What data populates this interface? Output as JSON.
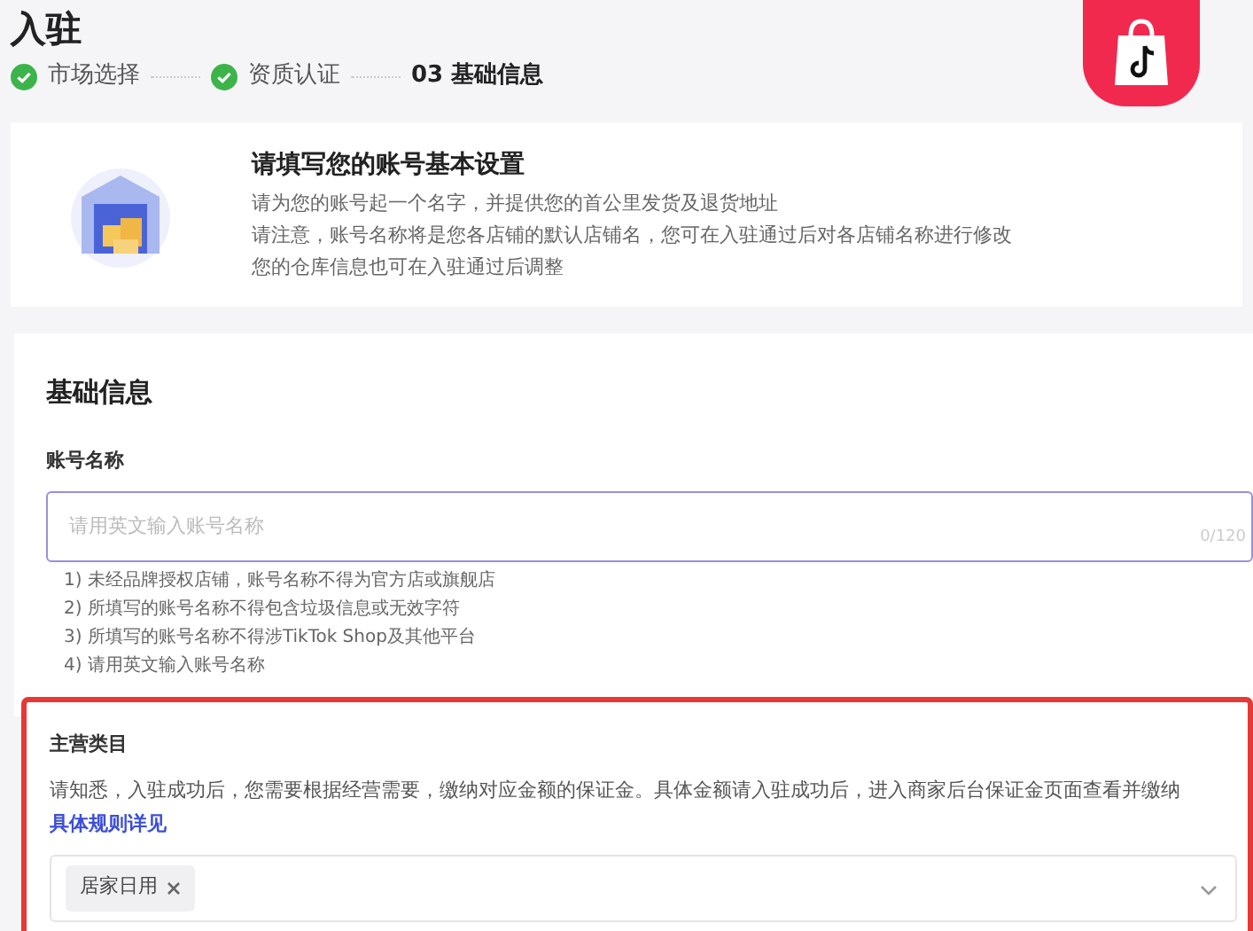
{
  "page": {
    "title": "入驻"
  },
  "steps": [
    {
      "label": "市场选择",
      "done": true
    },
    {
      "label": "资质认证",
      "done": true
    },
    {
      "label": "03 基础信息",
      "done": false
    }
  ],
  "intro": {
    "title": "请填写您的账号基本设置",
    "lines": [
      "请为您的账号起一个名字，并提供您的首公里发货及退货地址",
      "请注意，账号名称将是您各店铺的默认店铺名，您可在入驻通过后对各店铺名称进行修改",
      "您的仓库信息也可在入驻通过后调整"
    ]
  },
  "form": {
    "heading": "基础信息",
    "account_name": {
      "label": "账号名称",
      "placeholder": "请用英文输入账号名称",
      "counter": "0/120",
      "hints": [
        "1) 未经品牌授权店铺，账号名称不得为官方店或旗舰店",
        "2) 所填写的账号名称不得包含垃圾信息或无效字符",
        "3) 所填写的账号名称不得涉TikTok Shop及其他平台",
        "4) 请用英文输入账号名称"
      ]
    },
    "category": {
      "label": "主营类目",
      "notice": "请知悉，入驻成功后，您需要根据经营需要，缴纳对应金额的保证金。具体金额请入驻成功后，进入商家后台保证金页面查看并缴纳",
      "link": "具体规则详见",
      "tags": [
        "居家日用"
      ],
      "highlighted": true
    }
  }
}
